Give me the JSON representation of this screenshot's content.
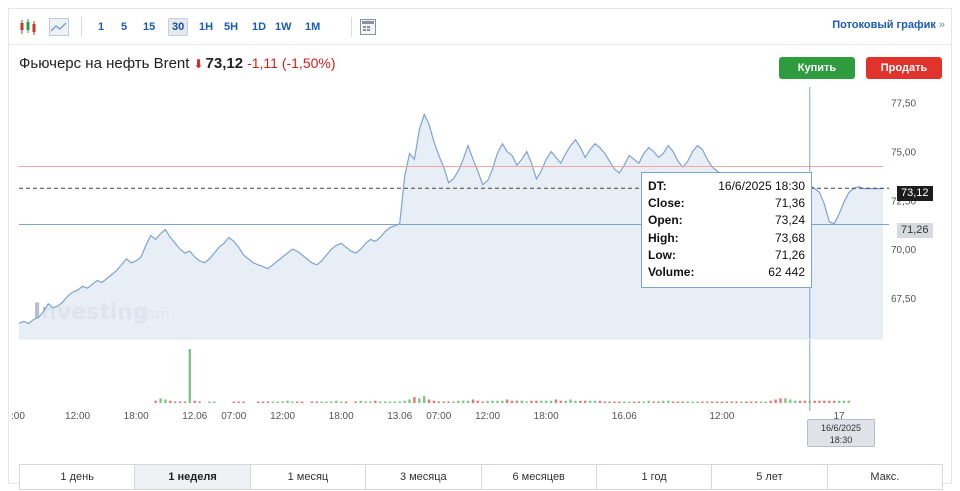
{
  "toolbar": {
    "chart_type_icons": [
      "candlestick-icon",
      "area-chart-icon"
    ],
    "intervals": [
      {
        "label": "1",
        "active": false
      },
      {
        "label": "5",
        "active": false
      },
      {
        "label": "15",
        "active": false
      },
      {
        "label": "30",
        "active": true
      },
      {
        "label": "1H",
        "active": false
      },
      {
        "label": "5H",
        "active": false
      },
      {
        "label": "1D",
        "active": false
      },
      {
        "label": "1W",
        "active": false
      },
      {
        "label": "1M",
        "active": false
      }
    ],
    "calendar_icon": "calendar-icon",
    "stream_link": "Потоковый график",
    "stream_arrow": "»"
  },
  "instrument": {
    "name": "Фьючерс на нефть Brent",
    "direction_icon": "down-arrow-icon",
    "price": "73,12",
    "change": "-1,11 (-1,50%)"
  },
  "actions": {
    "buy": "Купить",
    "sell": "Продать"
  },
  "colors": {
    "line": "#7fa3d1",
    "area": "#e3ebf4",
    "vol_up": "#7cc88a",
    "vol_down": "#e07a7a",
    "buy": "#2e9b3f",
    "sell": "#e0332b",
    "accent": "#1a5cba"
  },
  "watermark": {
    "bold": "Investing",
    "light": ".com"
  },
  "chart_data": {
    "type": "area",
    "title": "Фьючерс на нефть Brent",
    "ylim": [
      65.4,
      78.2
    ],
    "y_ticks": [
      "77,50",
      "75,00",
      "72,50",
      "70,00",
      "67,50"
    ],
    "y_tick_values": [
      77.5,
      75.0,
      72.5,
      70.0,
      67.5
    ],
    "x_ticks": [
      ":00",
      "12:00",
      "18:00",
      "12.06",
      "07:00",
      "12:00",
      "18:00",
      "13.06",
      "07:00",
      "12:00",
      "18:00",
      "16.06",
      "12:00",
      "17"
    ],
    "x_tick_index": [
      0,
      12,
      24,
      36,
      44,
      54,
      66,
      78,
      86,
      96,
      108,
      124,
      144,
      168
    ],
    "current_price": 73.12,
    "current_price_label": "73,12",
    "reference_price": 74.23,
    "crosshair_price": 71.26,
    "crosshair_label": "71,26",
    "crosshair_index": 162,
    "crosshair_date": [
      "16/6/2025",
      "18:30"
    ],
    "grid": false,
    "legend": "none",
    "close": [
      66.2,
      66.3,
      66.2,
      66.4,
      66.5,
      66.8,
      67.2,
      67.0,
      67.1,
      67.3,
      67.6,
      67.8,
      67.9,
      68.1,
      68.0,
      68.2,
      68.4,
      68.3,
      68.5,
      68.7,
      68.9,
      69.2,
      69.5,
      69.3,
      69.4,
      69.6,
      70.2,
      70.7,
      70.5,
      70.8,
      71.0,
      70.6,
      70.3,
      70.0,
      69.8,
      69.9,
      69.6,
      69.4,
      69.3,
      69.5,
      69.8,
      70.1,
      70.3,
      70.6,
      70.4,
      70.1,
      69.7,
      69.5,
      69.3,
      69.2,
      69.1,
      69.0,
      69.2,
      69.4,
      69.6,
      69.8,
      70.0,
      69.9,
      69.7,
      69.5,
      69.3,
      69.2,
      69.4,
      69.7,
      70.0,
      70.2,
      70.3,
      70.1,
      69.9,
      69.8,
      70.0,
      70.3,
      70.5,
      70.4,
      70.6,
      70.9,
      71.1,
      71.2,
      71.3,
      73.7,
      74.9,
      74.6,
      76.1,
      76.9,
      76.4,
      75.5,
      74.8,
      74.2,
      73.4,
      73.6,
      74.0,
      74.6,
      75.3,
      74.6,
      74.0,
      73.3,
      73.5,
      74.1,
      74.9,
      75.4,
      75.0,
      74.8,
      74.3,
      74.6,
      75.0,
      74.4,
      73.6,
      74.0,
      74.6,
      75.0,
      74.7,
      74.4,
      74.9,
      75.3,
      75.6,
      75.2,
      74.7,
      75.1,
      75.4,
      75.2,
      74.9,
      74.5,
      74.1,
      73.9,
      74.3,
      74.8,
      74.6,
      74.4,
      74.9,
      75.2,
      75.0,
      74.7,
      74.9,
      75.3,
      75.0,
      74.5,
      74.2,
      74.5,
      75.0,
      75.3,
      75.1,
      74.6,
      74.2,
      74.0,
      73.8,
      73.6,
      73.5,
      73.3,
      73.4,
      73.2,
      73.0,
      72.7,
      72.9,
      73.2,
      73.1,
      72.9,
      72.7,
      72.8,
      73.0,
      73.2,
      73.1,
      73.0,
      73.3,
      73.1,
      72.9,
      72.3,
      71.4,
      71.3,
      71.8,
      72.4,
      72.9,
      73.1,
      73.2,
      73.1,
      73.1,
      73.1,
      73.1,
      73.1
    ],
    "volume": [
      0,
      0,
      0,
      0,
      0,
      0,
      0,
      0,
      0,
      0,
      0,
      0,
      0,
      0,
      0,
      0,
      0,
      0,
      0,
      0,
      0,
      0,
      0,
      0,
      0,
      0,
      0,
      0,
      2,
      4,
      3,
      2,
      1,
      1,
      1,
      46,
      2,
      1,
      0,
      1,
      1,
      0,
      0,
      0,
      1,
      1,
      1,
      0,
      0,
      1,
      1,
      1,
      1,
      1,
      1,
      2,
      1,
      1,
      1,
      0,
      1,
      1,
      1,
      1,
      1,
      2,
      1,
      1,
      0,
      1,
      2,
      1,
      1,
      2,
      1,
      1,
      1,
      1,
      1,
      2,
      3,
      5,
      4,
      6,
      3,
      2,
      1,
      1,
      1,
      1,
      2,
      2,
      2,
      3,
      2,
      1,
      2,
      2,
      2,
      2,
      3,
      2,
      2,
      2,
      1,
      2,
      2,
      2,
      2,
      2,
      3,
      2,
      2,
      3,
      2,
      2,
      2,
      2,
      2,
      2,
      1,
      1,
      1,
      1,
      1,
      1,
      1,
      1,
      1,
      2,
      1,
      1,
      2,
      2,
      1,
      1,
      1,
      1,
      1,
      1,
      1,
      1,
      1,
      1,
      1,
      1,
      1,
      1,
      1,
      1,
      1,
      1,
      1,
      1,
      2,
      3,
      4,
      4,
      3,
      2,
      2,
      2,
      2,
      2,
      2,
      2,
      2,
      2,
      2,
      2,
      2
    ],
    "tooltip": {
      "rows": [
        {
          "label": "DT:",
          "value": "16/6/2025 18:30"
        },
        {
          "label": "Close:",
          "value": "71,36"
        },
        {
          "label": "Open:",
          "value": "73,24"
        },
        {
          "label": "High:",
          "value": "73,68"
        },
        {
          "label": "Low:",
          "value": "71,26"
        },
        {
          "label": "Volume:",
          "value": "62 442"
        }
      ]
    }
  },
  "periods": [
    {
      "label": "1 день",
      "active": false
    },
    {
      "label": "1 неделя",
      "active": true
    },
    {
      "label": "1 месяц",
      "active": false
    },
    {
      "label": "3 месяца",
      "active": false
    },
    {
      "label": "6 месяцев",
      "active": false
    },
    {
      "label": "1 год",
      "active": false
    },
    {
      "label": "5 лет",
      "active": false
    },
    {
      "label": "Макс.",
      "active": false
    }
  ]
}
